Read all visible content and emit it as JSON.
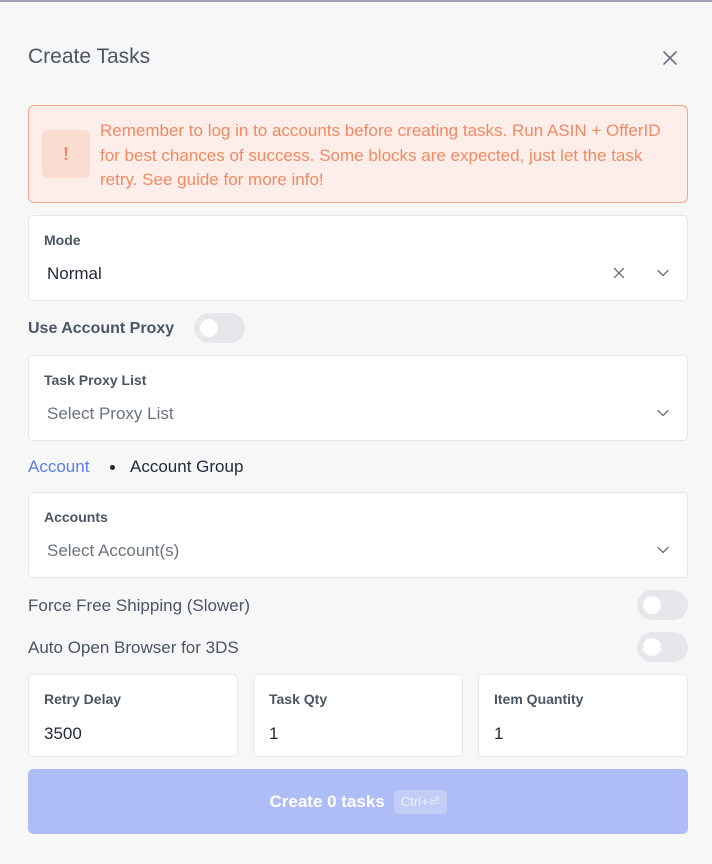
{
  "dialog": {
    "title": "Create Tasks"
  },
  "alert": {
    "icon_glyph": "!",
    "text": "Remember to log in to accounts before creating tasks. Run ASIN + OfferID for best chances of success. Some blocks are expected, just let the task retry. See guide for more info!"
  },
  "mode": {
    "label": "Mode",
    "value": "Normal"
  },
  "use_account_proxy": {
    "label": "Use Account Proxy",
    "enabled": false
  },
  "task_proxy_list": {
    "label": "Task Proxy List",
    "placeholder": "Select Proxy List"
  },
  "account_tabs": {
    "active": "Account",
    "other": "Account Group"
  },
  "accounts": {
    "label": "Accounts",
    "placeholder": "Select Account(s)"
  },
  "force_free_shipping": {
    "label": "Force Free Shipping (Slower)",
    "enabled": false
  },
  "auto_open_browser": {
    "label": "Auto Open Browser for 3DS",
    "enabled": false
  },
  "retry_delay": {
    "label": "Retry Delay",
    "value": "3500"
  },
  "task_qty": {
    "label": "Task Qty",
    "value": "1"
  },
  "item_quantity": {
    "label": "Item Quantity",
    "value": "1"
  },
  "create_button": {
    "label": "Create 0 tasks",
    "shortcut": "Ctrl+⏎"
  },
  "colors": {
    "accent": "#5b7ee5",
    "alert_text": "#f08a63",
    "alert_bg": "#fdeeea",
    "button_bg": "#aebdf5"
  }
}
